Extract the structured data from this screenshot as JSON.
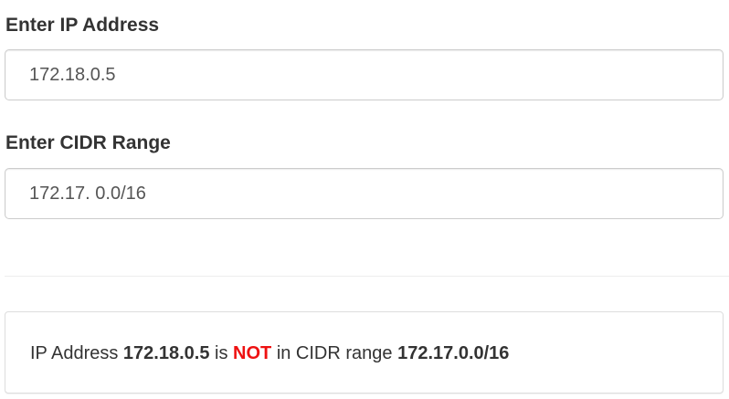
{
  "form": {
    "ip_label": "Enter IP Address",
    "ip_value": "172.18.0.5",
    "cidr_label": "Enter CIDR Range",
    "cidr_value": "172.17. 0.0/16"
  },
  "result": {
    "prefix": "IP Address",
    "ip": "172.18.0.5",
    "is_text": "is",
    "verdict": "NOT",
    "middle_text": "in CIDR range",
    "cidr": "172.17.0.0/16"
  },
  "colors": {
    "verdict": "#ee1111",
    "label": "#333333",
    "input_border": "#cccccc"
  }
}
